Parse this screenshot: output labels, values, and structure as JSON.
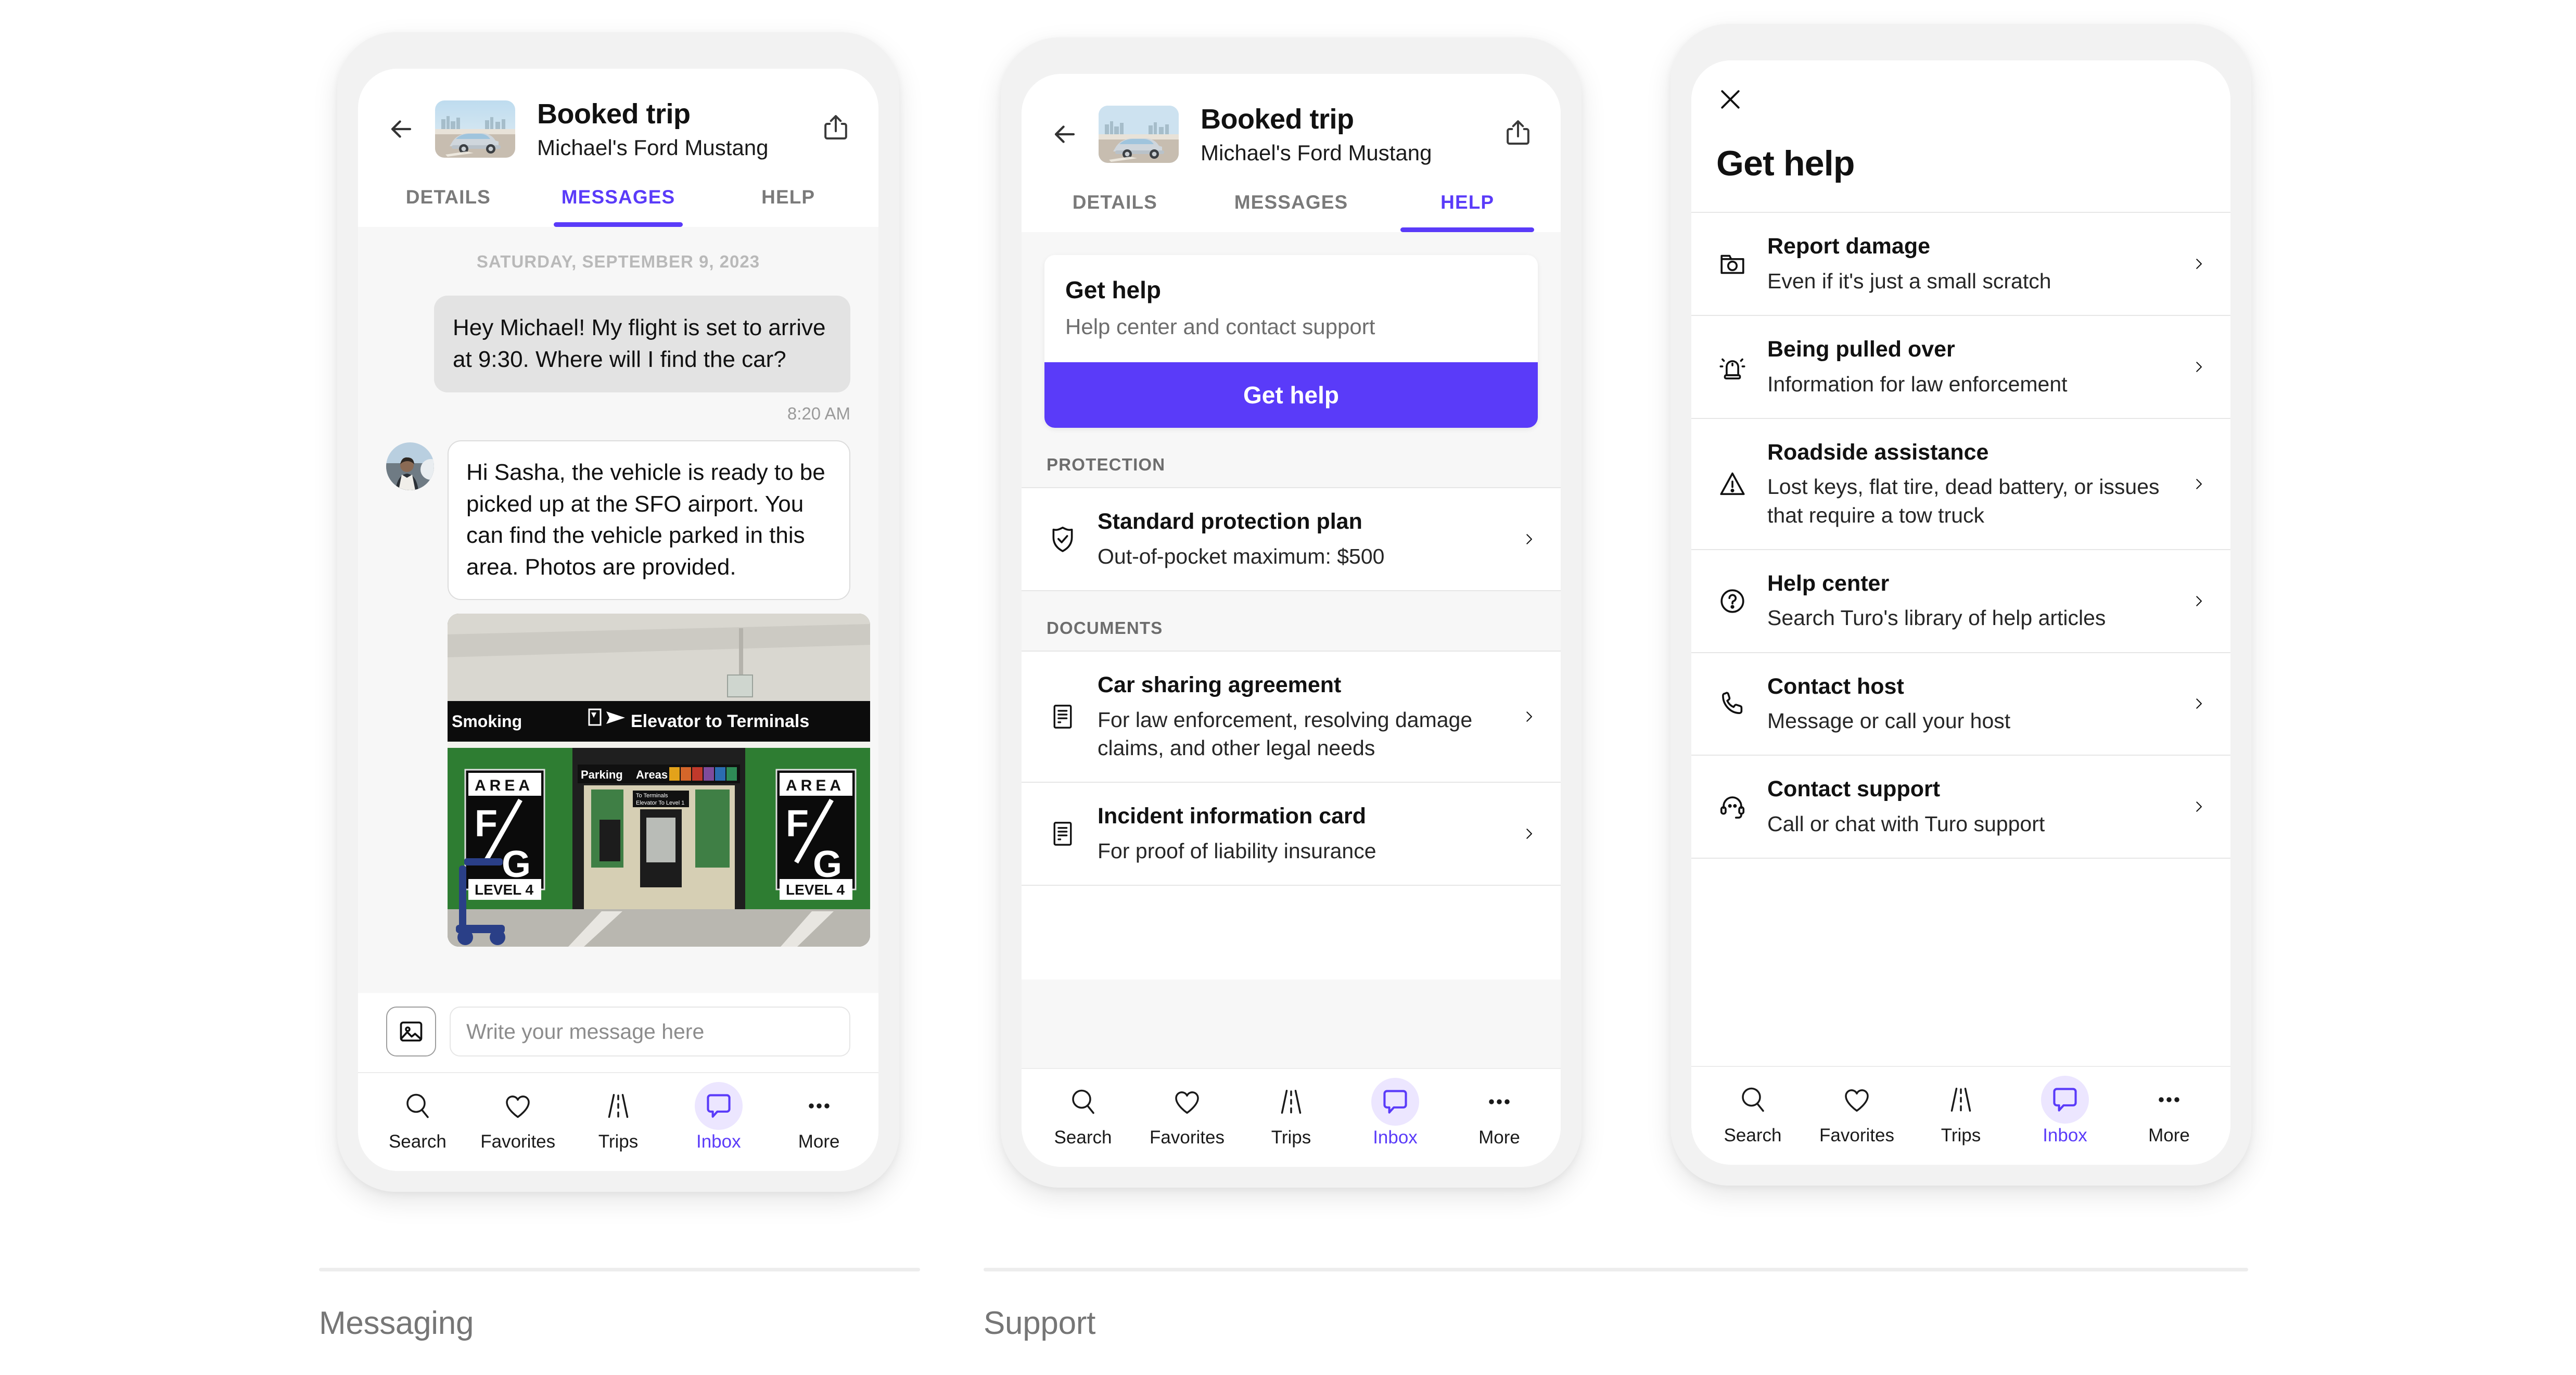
{
  "brand": {
    "accent": "#5A3BF9",
    "accent_soft": "#ECE6FF",
    "app_bg": "#F7F7F7"
  },
  "trip": {
    "title": "Booked trip",
    "subtitle": "Michael's Ford Mustang",
    "back_icon": "back-arrow-icon",
    "share_icon": "share-icon",
    "thumbnail_alt": "silver Ford Mustang convertible on rooftop parking with city skyline"
  },
  "tabs": [
    {
      "label": "DETAILS",
      "active": false
    },
    {
      "label": "MESSAGES",
      "active": true
    },
    {
      "label": "HELP",
      "active": false
    }
  ],
  "tabs_help": [
    {
      "label": "DETAILS",
      "active": false
    },
    {
      "label": "MESSAGES",
      "active": false
    },
    {
      "label": "HELP",
      "active": true
    }
  ],
  "messages": {
    "date_separator": "SATURDAY, SEPTEMBER 9, 2023",
    "outgoing": {
      "text": "Hey Michael! My flight is set to arrive at 9:30. Where will I find the car?",
      "time": "8:20 AM"
    },
    "incoming": {
      "text": "Hi Sasha, the vehicle is ready to be picked up at the SFO airport.  You can find the vehicle parked in this area. Photos are provided.",
      "avatar_alt": "host profile photo",
      "attachment_alt": "airport parking garage, Elevator to Terminals sign, Area F/G Level 4",
      "attachment_signs": {
        "banner_left": "Smoking",
        "banner_center": "Elevator to Terminals",
        "parking_label": "Parking",
        "areas_label": "Areas",
        "area_codes": "A/B B C D E F",
        "sign_area": "A R E A",
        "sign_fg": "F/G",
        "sign_level": "LEVEL 4",
        "inner_sign_l1": "To Terminals",
        "inner_sign_l2": "Elevator To Level 1"
      }
    }
  },
  "composer": {
    "attach_icon": "image-attachment-icon",
    "placeholder": "Write your message here",
    "value": ""
  },
  "bottom_nav": [
    {
      "label": "Search",
      "icon": "search-icon",
      "active": false
    },
    {
      "label": "Favorites",
      "icon": "heart-icon",
      "active": false
    },
    {
      "label": "Trips",
      "icon": "road-icon",
      "active": false
    },
    {
      "label": "Inbox",
      "icon": "chat-bubble-icon",
      "active": true
    },
    {
      "label": "More",
      "icon": "ellipsis-icon",
      "active": false
    }
  ],
  "help_tab": {
    "get_help_card": {
      "title": "Get help",
      "subtitle": "Help center and contact support",
      "button_label": "Get help"
    },
    "protection": {
      "section_label": "PROTECTION",
      "items": [
        {
          "icon": "shield-check-icon",
          "title": "Standard  protection plan",
          "subtitle": "Out-of-pocket maximum: $500"
        }
      ]
    },
    "documents": {
      "section_label": "DOCUMENTS",
      "items": [
        {
          "icon": "document-icon",
          "title": "Car sharing agreement",
          "subtitle": "For law enforcement, resolving damage claims, and other legal needs"
        },
        {
          "icon": "document-icon",
          "title": "Incident information card",
          "subtitle": "For proof of liability insurance"
        }
      ]
    }
  },
  "get_help_sheet": {
    "close_icon": "close-icon",
    "title": "Get help",
    "items": [
      {
        "icon": "camera-icon",
        "title": "Report damage",
        "subtitle": "Even if it's just a small scratch"
      },
      {
        "icon": "siren-icon",
        "title": "Being pulled over",
        "subtitle": "Information for law enforcement"
      },
      {
        "icon": "warning-triangle-icon",
        "title": "Roadside assistance",
        "subtitle": "Lost keys, flat tire, dead battery, or issues that require a tow truck"
      },
      {
        "icon": "question-circle-icon",
        "title": "Help center",
        "subtitle": "Search Turo's library of help articles"
      },
      {
        "icon": "phone-icon",
        "title": "Contact host",
        "subtitle": "Message or call your host"
      },
      {
        "icon": "headset-icon",
        "title": "Contact support",
        "subtitle": "Call or chat with Turo support"
      }
    ]
  },
  "captions": [
    {
      "label": "Messaging"
    },
    {
      "label": "Support"
    }
  ]
}
